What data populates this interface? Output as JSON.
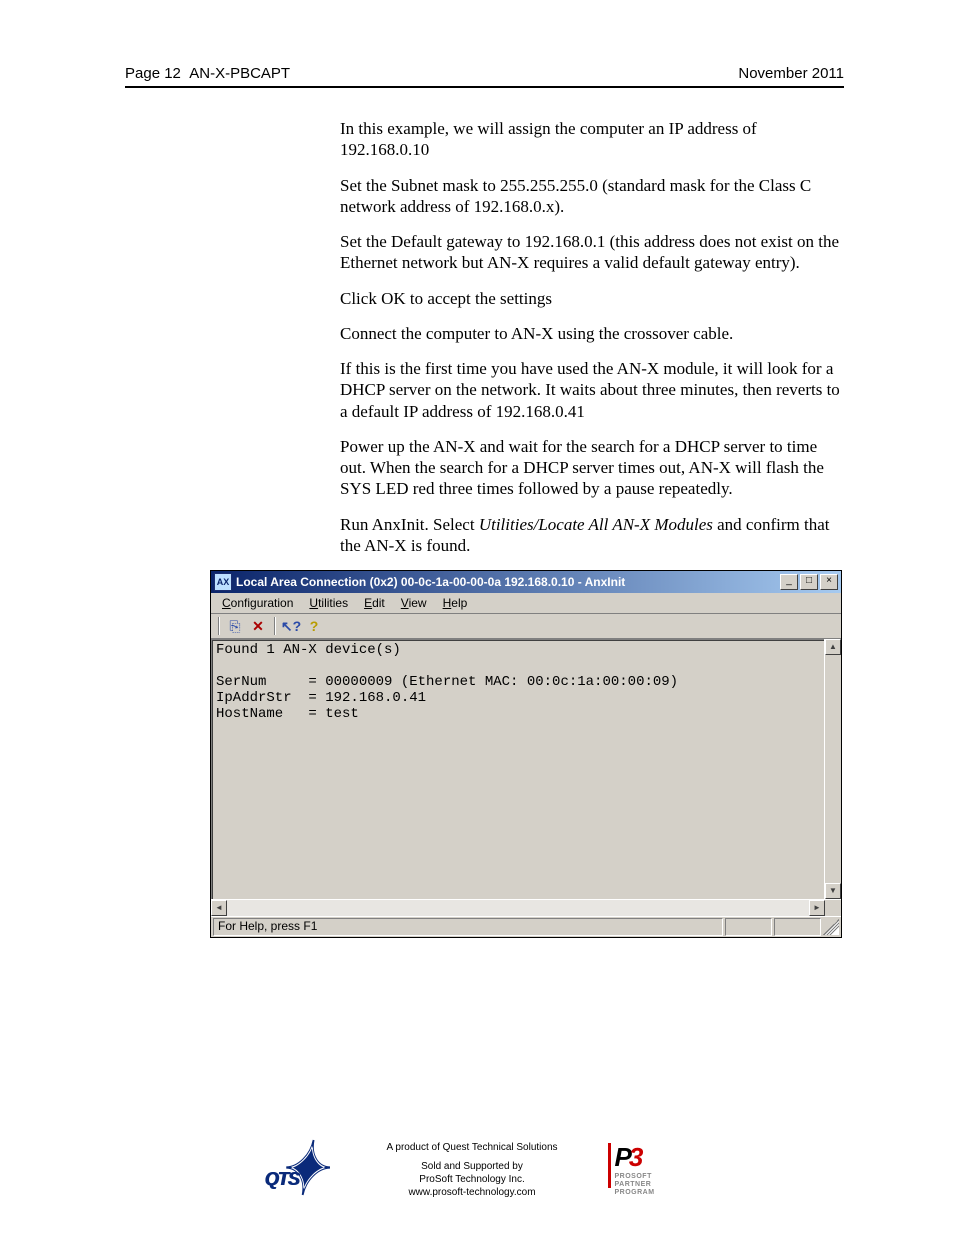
{
  "header": {
    "page_label": "Page",
    "page_number": "12",
    "doc_title": "AN-X-PBCAPT",
    "date": "November 2011"
  },
  "body": {
    "p1": "In this example, we will assign the computer an IP address of 192.168.0.10",
    "p2": "Set the Subnet mask to 255.255.255.0 (standard mask for the Class C network address of 192.168.0.x).",
    "p3": "Set the Default gateway to 192.168.0.1 (this address does not exist on the Ethernet network but AN-X requires a valid default gateway entry).",
    "p4": "Click OK to accept the settings",
    "p5": "Connect the computer to AN-X using the crossover cable.",
    "p6": "If this is the first time you have used the AN-X module, it will look for a DHCP server on the network.  It waits about three minutes, then reverts to a default IP address of 192.168.0.41",
    "p7": "Power up the AN-X and wait for the search for a DHCP server to time out.  When the search for a DHCP server times out, AN-X will flash the SYS LED red three times followed by a pause repeatedly.",
    "p8a": "Run AnxInit.  Select ",
    "p8i": "Utilities/Locate All AN-X Modules",
    "p8b": " and confirm that the AN-X is found."
  },
  "window": {
    "title": "Local Area Connection (0x2) 00-0c-1a-00-00-0a  192.168.0.10 - AnxInit",
    "app_icon_text": "AX",
    "btn_min": "_",
    "btn_max": "□",
    "btn_close": "×",
    "menus": {
      "configuration": "Configuration",
      "utilities": "Utilities",
      "edit": "Edit",
      "view": "View",
      "help": "Help"
    },
    "toolbar": {
      "copy": "⎘",
      "delete": "✕",
      "whats_this": "⁇",
      "help": "?"
    },
    "console": "Found 1 AN-X device(s)\n\nSerNum     = 00000009 (Ethernet MAC: 00:0c:1a:00:00:09)\nIpAddrStr  = 192.168.0.41\nHostName   = test\n",
    "status": "For Help, press F1"
  },
  "footer": {
    "qts": "QTS",
    "line1": "A product of Quest Technical Solutions",
    "line2": "Sold and Supported by",
    "line3": "ProSoft Technology Inc.",
    "line4": "www.prosoft-technology.com",
    "p3_1": "PROSOFT",
    "p3_2": "PARTNER",
    "p3_3": "PROGRAM"
  }
}
